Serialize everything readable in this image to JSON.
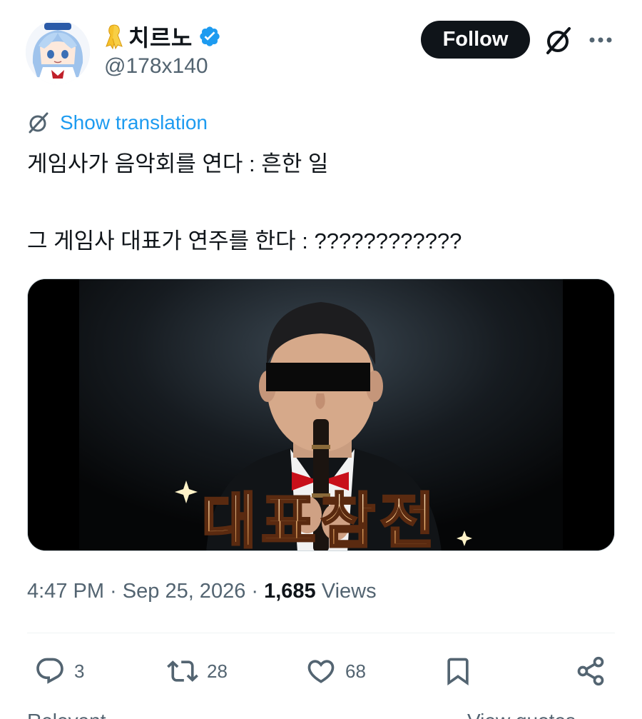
{
  "author": {
    "display_name": "치르노",
    "handle": "@178x140",
    "verified": true
  },
  "header": {
    "follow_label": "Follow",
    "grok_icon": "grok-icon",
    "more_icon": "more-icon"
  },
  "translation": {
    "link_label": "Show translation"
  },
  "tweet": {
    "line1": "게임사가 음악회를 연다 : 흔한 일",
    "line2": "그 게임사 대표가 연주를 한다 : ????????????"
  },
  "media": {
    "overlay_text": "대표참전"
  },
  "meta": {
    "time": "4:47 PM",
    "separator": " · ",
    "date": "Sep 25, 2026",
    "views_count": "1,685",
    "views_label": " Views"
  },
  "actions": {
    "reply_count": "3",
    "retweet_count": "28",
    "like_count": "68"
  },
  "bottom": {
    "left_text": "Relevant",
    "right_text": "View quotes"
  },
  "colors": {
    "accent": "#1d9bf0",
    "text": "#0f1419",
    "muted": "#536471",
    "follow_bg": "#0f1419",
    "bowtie": "#d10f1a"
  }
}
